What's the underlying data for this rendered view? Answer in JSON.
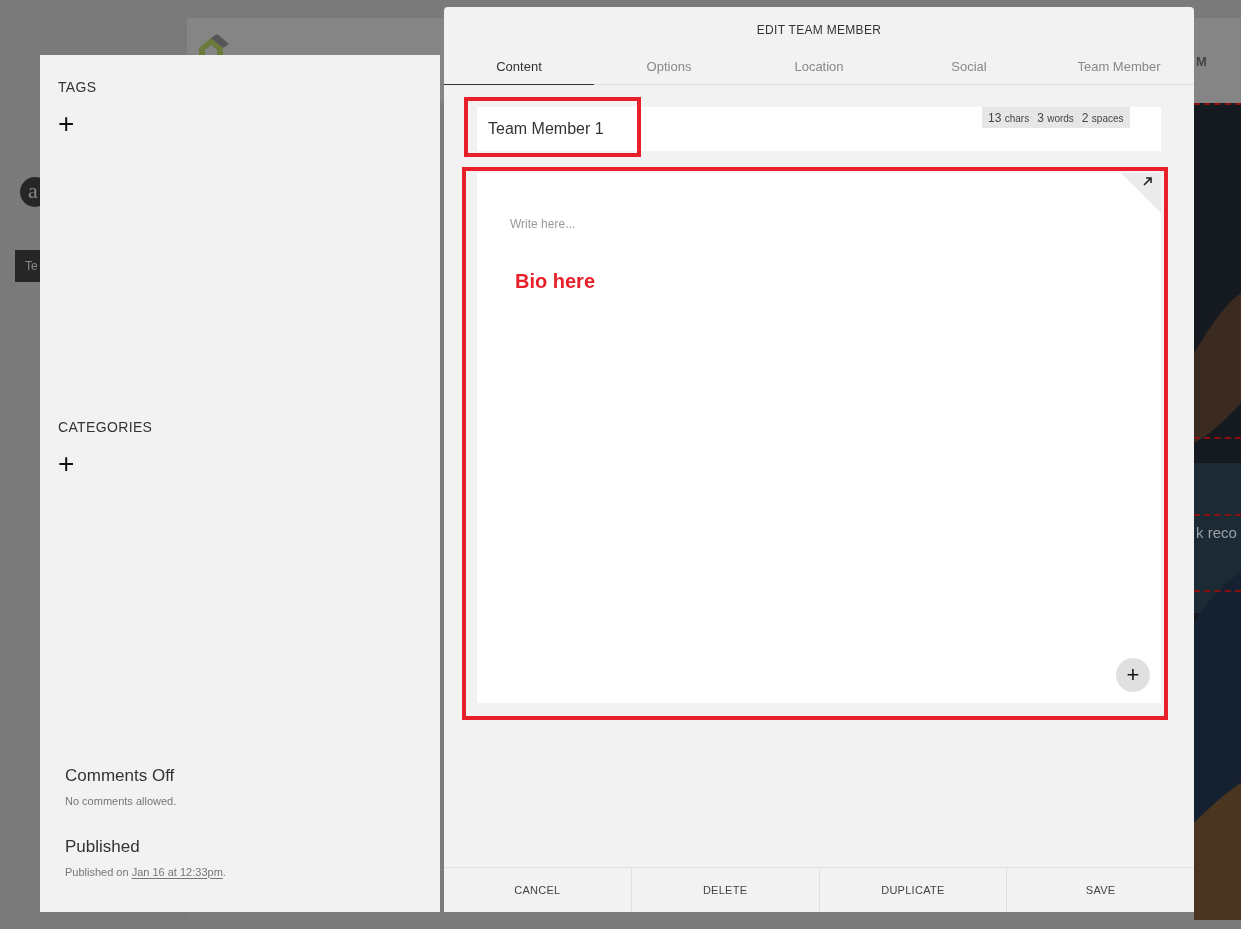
{
  "background_page": {
    "nav_fragment": "M",
    "avatar_letter": "a",
    "button_fragment": "Te",
    "hero_text_fragment": "k reco"
  },
  "sidebar": {
    "sections": [
      {
        "kind": "adder",
        "heading": "TAGS",
        "add_icon": "+"
      },
      {
        "kind": "adder",
        "heading": "CATEGORIES",
        "add_icon": "+"
      },
      {
        "kind": "setting",
        "title": "Comments Off",
        "description": "No comments allowed."
      },
      {
        "kind": "setting",
        "title": "Published",
        "description": "Published on ",
        "link": "Jan 16 at 12:33pm",
        "suffix": "."
      }
    ]
  },
  "dialog": {
    "title": "EDIT TEAM MEMBER",
    "tabs": [
      {
        "label": "Content",
        "selected": true
      },
      {
        "label": "Options",
        "selected": false
      },
      {
        "label": "Location",
        "selected": false
      },
      {
        "label": "Social",
        "selected": false
      },
      {
        "label": "Team Member",
        "selected": false
      }
    ],
    "title_field": {
      "value": "Team Member 1",
      "counts": [
        {
          "number": "13",
          "unit": "chars"
        },
        {
          "number": "3",
          "unit": "words"
        },
        {
          "number": "2",
          "unit": "spaces"
        }
      ]
    },
    "editor": {
      "placeholder": "Write here...",
      "annotation": "Bio here",
      "add_button": "+"
    },
    "buttons": [
      "CANCEL",
      "DELETE",
      "DUPLICATE",
      "SAVE"
    ]
  }
}
